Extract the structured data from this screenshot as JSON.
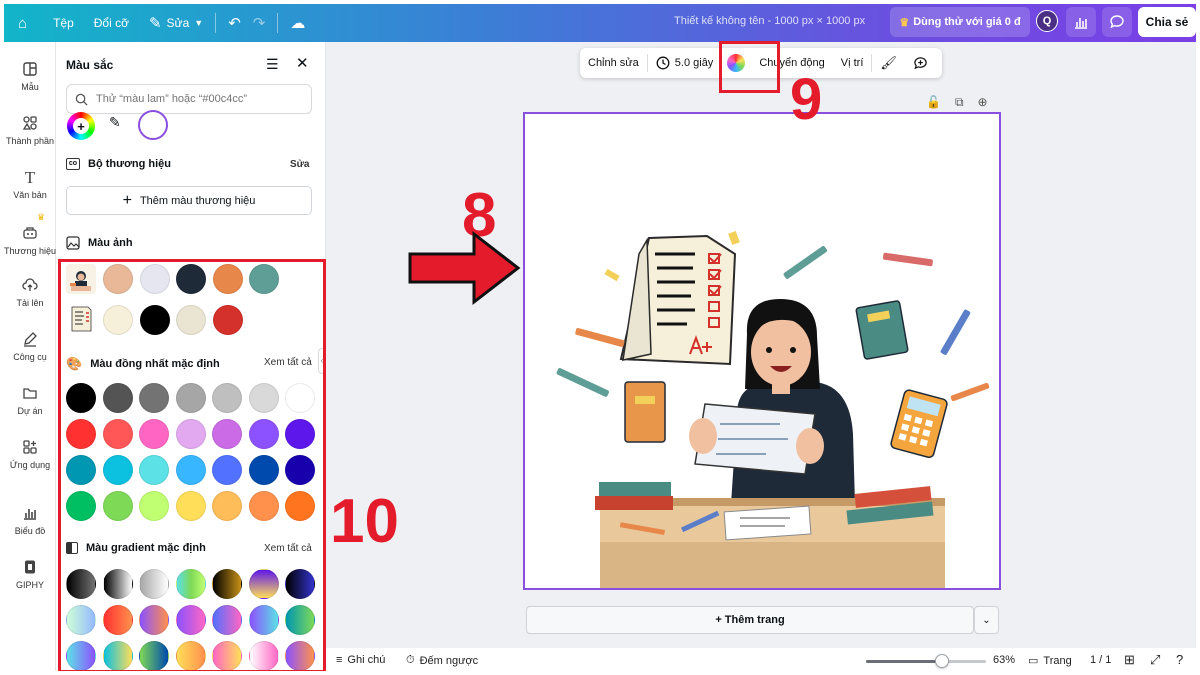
{
  "topbar": {
    "file": "Tệp",
    "resize": "Đổi cỡ",
    "edit": "Sửa",
    "title": "Thiết kế không tên - 1000 px × 1000 px",
    "trial": "Dùng thử với giá 0 đ",
    "avatar_letter": "Q",
    "share": "Chia sẻ"
  },
  "leftnav": [
    {
      "label": "Mẫu",
      "icon": "template-icon"
    },
    {
      "label": "Thành phần",
      "icon": "elements-icon"
    },
    {
      "label": "Văn bản",
      "icon": "text-icon"
    },
    {
      "label": "Thương hiệu",
      "icon": "brand-icon"
    },
    {
      "label": "Tải lên",
      "icon": "upload-icon"
    },
    {
      "label": "Công cụ",
      "icon": "draw-icon"
    },
    {
      "label": "Dự án",
      "icon": "folder-icon"
    },
    {
      "label": "Ứng dụng",
      "icon": "apps-icon"
    },
    {
      "label": "Biểu đồ",
      "icon": "chart-icon"
    },
    {
      "label": "GIPHY",
      "icon": "giphy-icon"
    }
  ],
  "panel": {
    "title": "Màu sắc",
    "search_placeholder": "Thử “màu lam” hoặc “#00c4cc”",
    "brand_kit": "Bộ thương hiệu",
    "brand_edit": "Sửa",
    "add_brand": "Thêm màu thương hiệu",
    "photo_colors": "Màu ảnh",
    "solid_title": "Màu đồng nhất mặc định",
    "see_all": "Xem tất cả",
    "gradient_title": "Màu gradient mặc định",
    "see_all_2": "Xem tất cả",
    "photo_row1": [
      "#e8b898",
      "#e6e6f0",
      "#1f2a38",
      "#e8874a",
      "#5f9e96"
    ],
    "photo_row2": [
      "#f6efd9",
      "#000000",
      "#e9e5d2",
      "#d4302c"
    ],
    "solids": [
      [
        "#000000",
        "#545454",
        "#737373",
        "#a6a6a6",
        "#bfbfbf",
        "#d9d9d9",
        "#ffffff"
      ],
      [
        "#ff3131",
        "#ff5757",
        "#ff66c4",
        "#e2a9f1",
        "#cb6ce6",
        "#8c52ff",
        "#5e17eb"
      ],
      [
        "#0097b2",
        "#0cc0df",
        "#5ce1e6",
        "#38b6ff",
        "#5271ff",
        "#004aad",
        "#1800ad"
      ],
      [
        "#00bf63",
        "#7ed957",
        "#c1ff72",
        "#ffde59",
        "#ffbd59",
        "#ff914d",
        "#ff751f"
      ]
    ],
    "gradients": [
      [
        "linear-gradient(90deg,#000,#737373)",
        "linear-gradient(90deg,#000,#fff)",
        "linear-gradient(90deg,#a6a6a6,#fff)",
        "linear-gradient(90deg,#5de0e6,#7ed957,#c1ff72)",
        "linear-gradient(90deg,#000,#c89116)",
        "linear-gradient(180deg,#5e17eb,#ffde59)",
        "linear-gradient(90deg,#000,#3533cd)"
      ],
      [
        "linear-gradient(90deg,#cdffd8,#94b9ff)",
        "linear-gradient(90deg,#ff3131,#ff914d)",
        "linear-gradient(90deg,#8c52ff,#ff914d)",
        "linear-gradient(90deg,#8c52ff,#ff66c4)",
        "linear-gradient(90deg,#5170ff,#ff66c4)",
        "linear-gradient(90deg,#8c52ff,#5ce1e6)",
        "linear-gradient(90deg,#0097b2,#7ed957)"
      ],
      [
        "linear-gradient(90deg,#5ce1e6,#8c52ff)",
        "linear-gradient(90deg,#0cc0df,#ffde59)",
        "linear-gradient(90deg,#7ed957,#004aad)",
        "linear-gradient(90deg,#ffde59,#ff914d)",
        "linear-gradient(90deg,#ff66c4,#ffde59)",
        "linear-gradient(90deg,#ffffff,#ff66c4)",
        "linear-gradient(90deg,#8c52ff,#ff914d)"
      ]
    ]
  },
  "float_toolbar": {
    "edit": "Chỉnh sửa",
    "duration": "5.0 giây",
    "animate": "Chuyển động",
    "position": "Vị trí"
  },
  "annotations": {
    "eight": "8",
    "nine": "9",
    "ten": "10"
  },
  "add_page": "+ Thêm trang",
  "bottombar": {
    "notes": "Ghi chú",
    "timer": "Đếm ngược",
    "zoom": "63%",
    "zoom_level": 0.63,
    "pages_label": "Trang",
    "page_count": "1 / 1"
  },
  "colors": {
    "accent": "#8b4fe0",
    "annotation": "#e41b2b"
  }
}
